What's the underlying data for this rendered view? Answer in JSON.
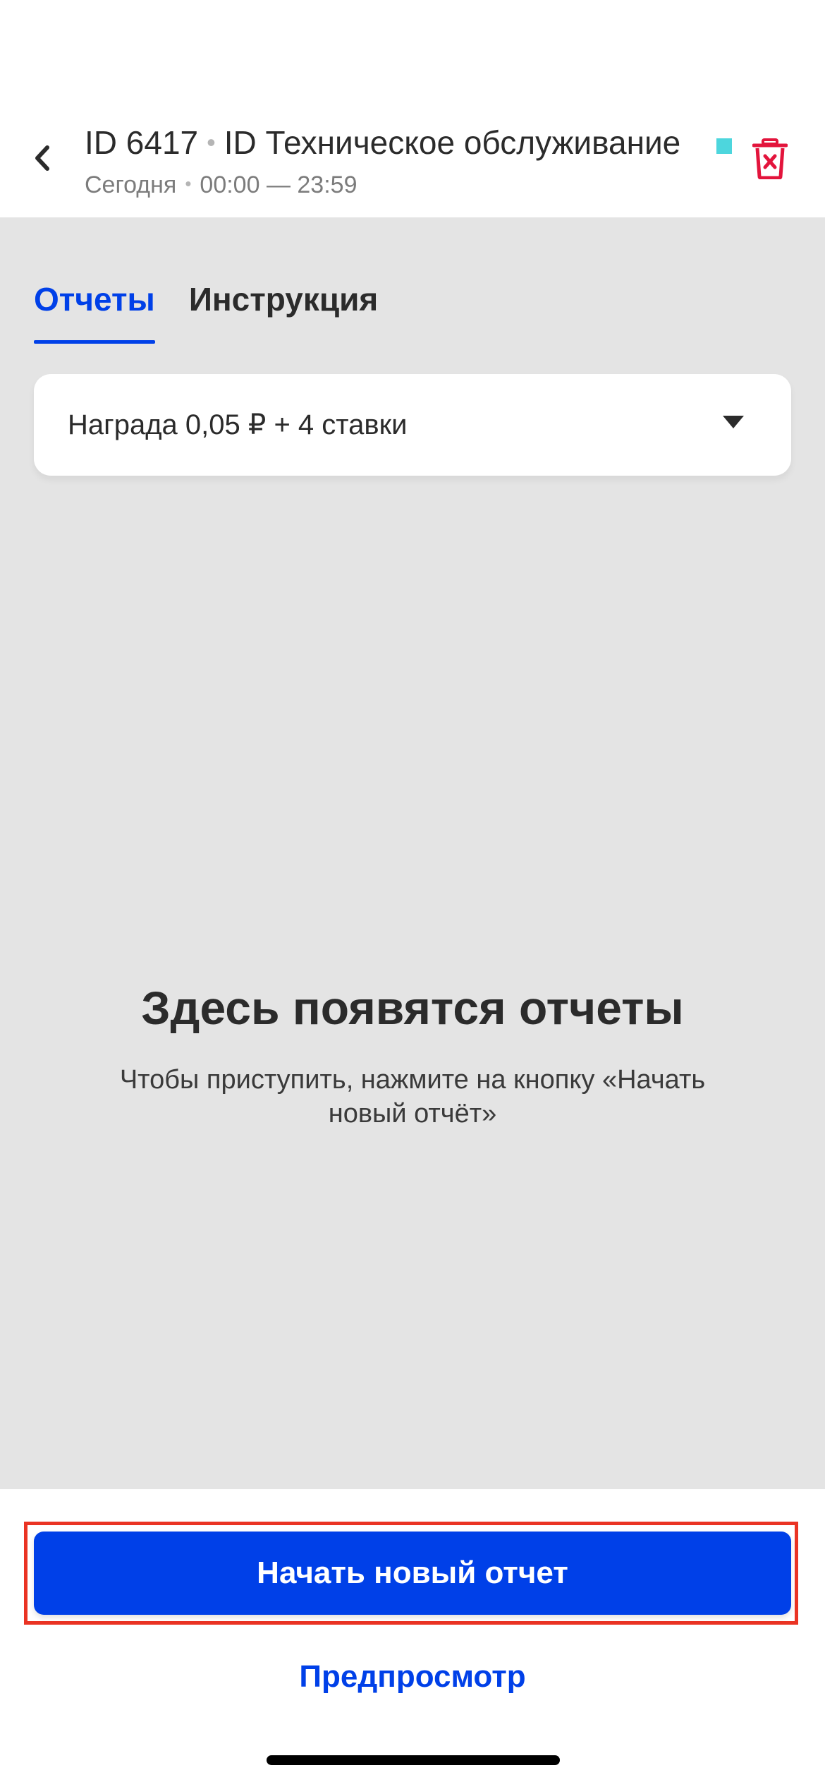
{
  "colors": {
    "accent": "#0040e8",
    "danger": "#e3143c",
    "status": "#4dd6dd",
    "highlight": "#ea3323",
    "tab_inactive": "#2b2b2b"
  },
  "header": {
    "back_icon": "chevron-left-icon",
    "task_id": "ID 6417",
    "task_name": "ID Техническое обслуживание",
    "date": "Сегодня",
    "time_range": "00:00 — 23:59",
    "delete_icon": "trash-icon"
  },
  "tabs": [
    {
      "label": "Отчеты",
      "active": true
    },
    {
      "label": "Инструкция",
      "active": false
    }
  ],
  "reward_dropdown": {
    "label": "Награда 0,05 ₽ + 4 ставки",
    "icon": "caret-down-icon"
  },
  "empty_state": {
    "title": "Здесь появятся отчеты",
    "description": "Чтобы приступить, нажмите на кнопку «Начать новый отчёт»"
  },
  "actions": {
    "start_report": "Начать новый отчет",
    "preview": "Предпросмотр"
  }
}
